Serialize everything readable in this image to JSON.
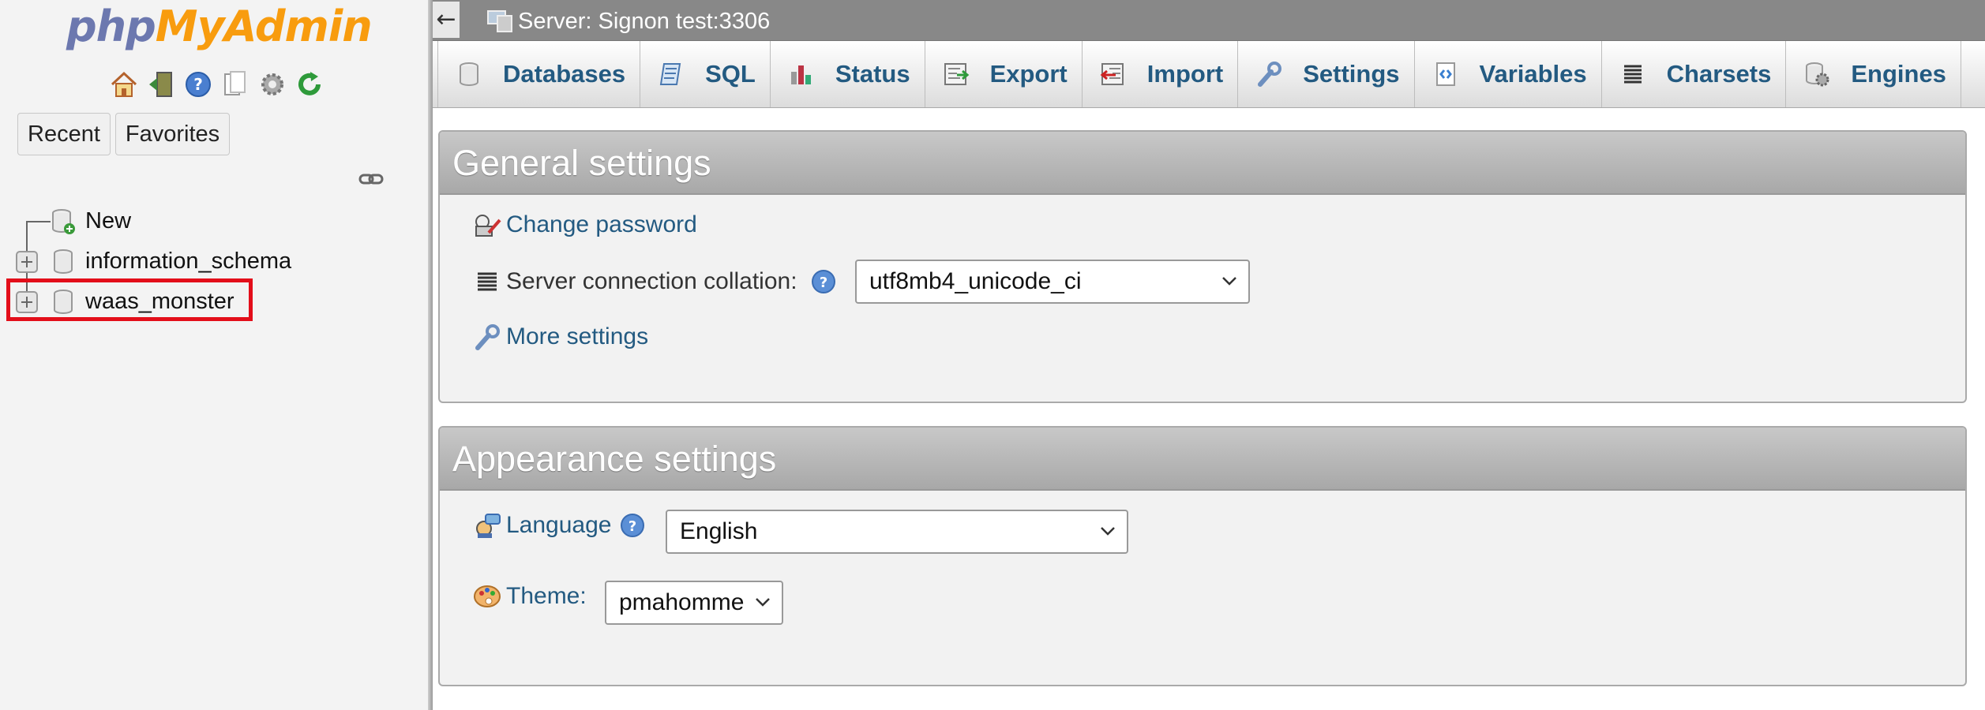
{
  "logo": {
    "php": "php",
    "my": "My",
    "admin": "Admin"
  },
  "nav": {
    "icons": [
      "home-icon",
      "logout-icon",
      "help-icon",
      "docs-icon",
      "settings-icon",
      "reload-icon"
    ],
    "recent_label": "Recent",
    "favorites_label": "Favorites",
    "tree": [
      {
        "label": "New",
        "type": "new"
      },
      {
        "label": "information_schema",
        "type": "database"
      },
      {
        "label": "waas_monster",
        "type": "database",
        "highlighted": true
      }
    ]
  },
  "topbar": {
    "collapse_symbol": "←",
    "server_label": "Server: Signon test:3306"
  },
  "menu": [
    {
      "label": "Databases",
      "icon": "database-icon"
    },
    {
      "label": "SQL",
      "icon": "sql-icon"
    },
    {
      "label": "Status",
      "icon": "status-icon"
    },
    {
      "label": "Export",
      "icon": "export-icon"
    },
    {
      "label": "Import",
      "icon": "import-icon"
    },
    {
      "label": "Settings",
      "icon": "wrench-icon"
    },
    {
      "label": "Variables",
      "icon": "variables-icon"
    },
    {
      "label": "Charsets",
      "icon": "charsets-icon"
    },
    {
      "label": "Engines",
      "icon": "engines-icon"
    }
  ],
  "general": {
    "title": "General settings",
    "change_password": "Change password",
    "collation_label": "Server connection collation:",
    "collation_value": "utf8mb4_unicode_ci",
    "more_settings": "More settings"
  },
  "appearance": {
    "title": "Appearance settings",
    "language_label": "Language",
    "language_value": "English",
    "theme_label": "Theme:",
    "theme_value": "pmahomme"
  },
  "colors": {
    "link": "#235a81",
    "highlight": "#e30e1a",
    "topbar": "#888888"
  }
}
